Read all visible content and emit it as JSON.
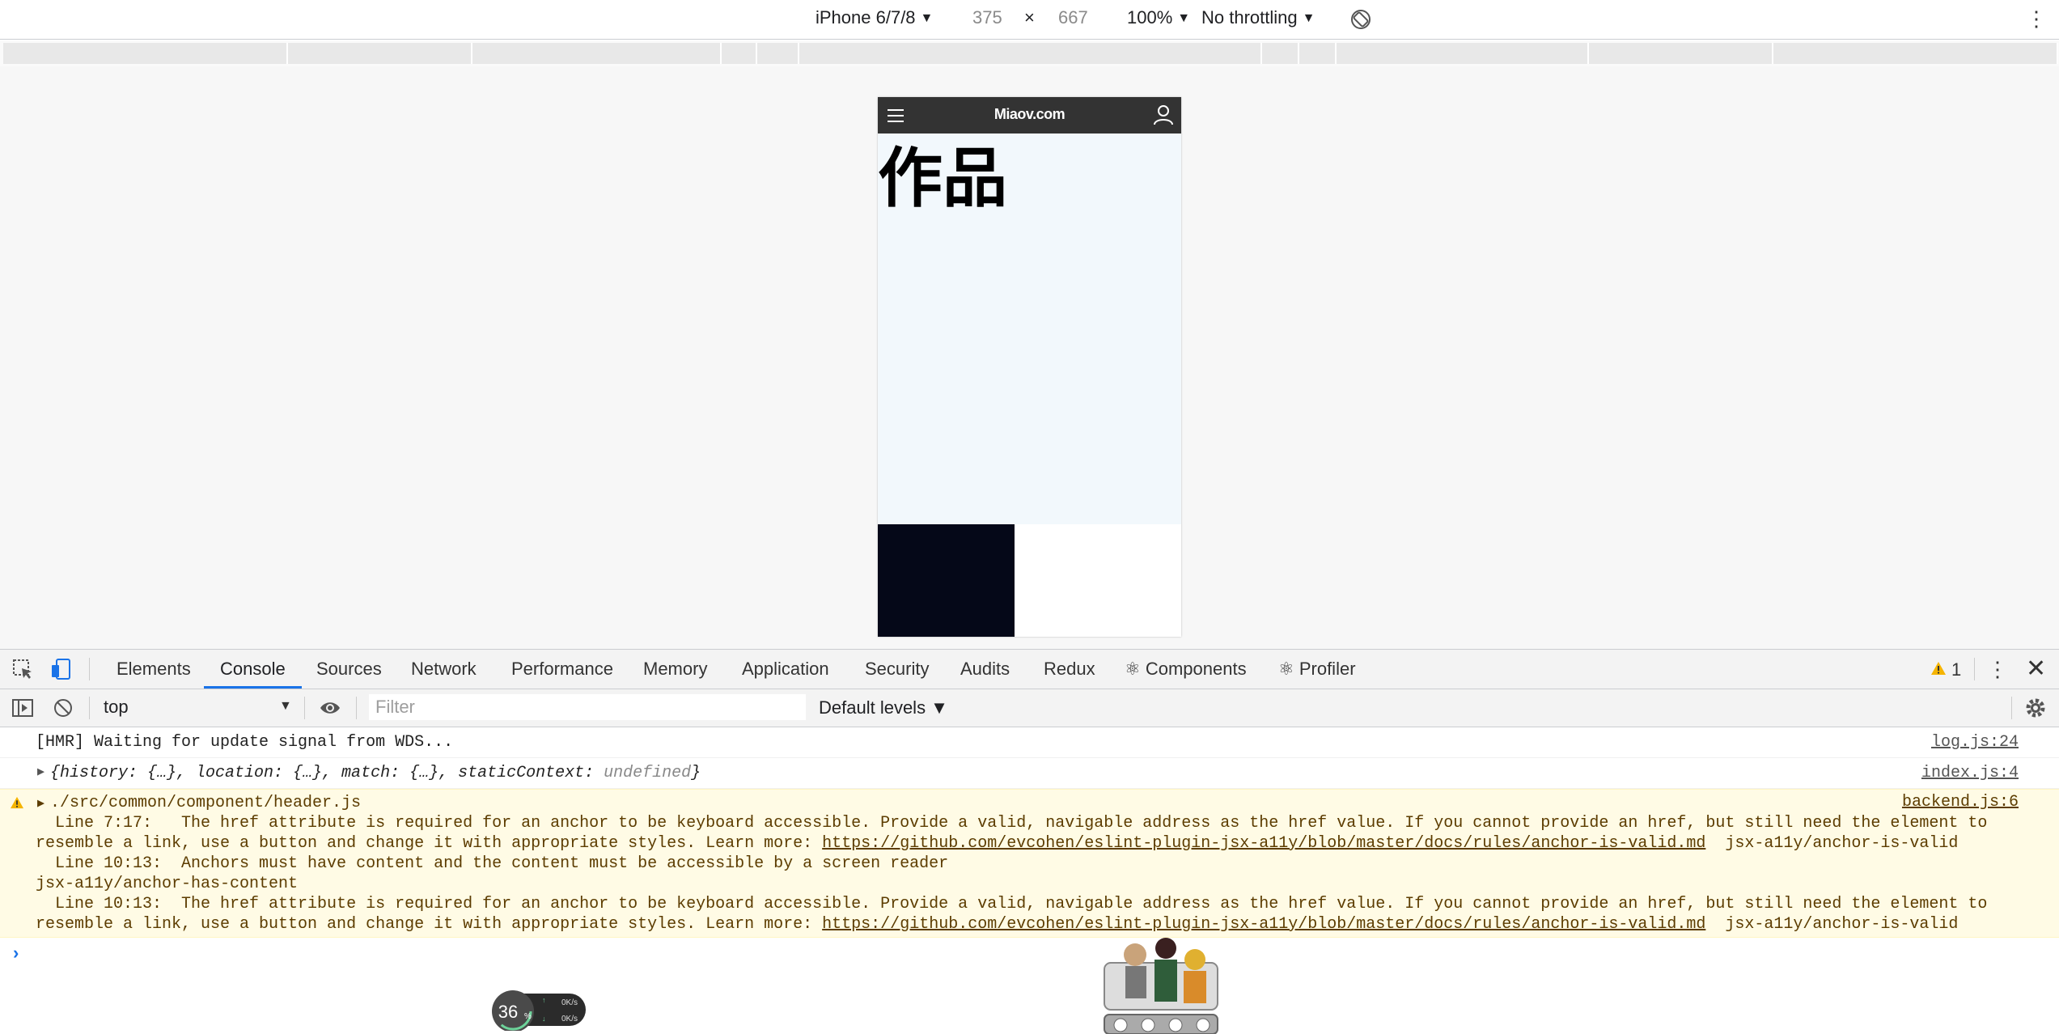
{
  "device_toolbar": {
    "device": "iPhone 6/7/8",
    "width": "375",
    "times": "×",
    "height": "667",
    "zoom": "100%",
    "throttling": "No throttling",
    "caret": "▼",
    "more": "⋮"
  },
  "app": {
    "logo": "Miaov.com",
    "heading": "作品"
  },
  "devtools": {
    "tabs": [
      "Elements",
      "Console",
      "Sources",
      "Network",
      "Performance",
      "Memory",
      "Application",
      "Security",
      "Audits",
      "Redux",
      "⚛ Components",
      "⚛ Profiler"
    ],
    "active_tab": "Console",
    "warning_count": "1",
    "more": "⋮",
    "close": "✕"
  },
  "console_toolbar": {
    "context": "top",
    "filter_placeholder": "Filter",
    "levels": "Default levels ▼"
  },
  "console": {
    "msg1": {
      "text": "[HMR] Waiting for update signal from WDS...",
      "source": "log.js:24"
    },
    "msg2": {
      "text_open": "{history: {…}, location: {…}, match: {…}, staticContext: ",
      "text_undef": "undefined",
      "text_close": "}",
      "source": "index.js:4"
    },
    "warning": {
      "title": "./src/common/component/header.js",
      "source": "backend.js:6",
      "line1": "  Line 7:17:   The href attribute is required for an anchor to be keyboard accessible. Provide a valid, navigable address as the href value. If you cannot provide an href, but still need the element to",
      "line2_pre": "resemble a link, use a button and change it with appropriate styles. Learn more: ",
      "url": "https://github.com/evcohen/eslint-plugin-jsx-a11y/blob/master/docs/rules/anchor-is-valid.md",
      "rule_valid": "  jsx-a11y/anchor-is-valid",
      "line3": "  Line 10:13:  Anchors must have content and the content must be accessible by a screen reader",
      "line4": "jsx-a11y/anchor-has-content",
      "line5": "  Line 10:13:  The href attribute is required for an anchor to be keyboard accessible. Provide a valid, navigable address as the href value. If you cannot provide an href, but still need the element to",
      "line6_pre": "resemble a link, use a button and change it with appropriate styles. Learn more: ",
      "url2": "https://github.com/evcohen/eslint-plugin-jsx-a11y/blob/master/docs/rules/anchor-is-valid.md",
      "rule_valid2": "  jsx-a11y/anchor-is-valid"
    },
    "prompt": "›"
  },
  "speed_widget": {
    "percent": "36",
    "unit": "%",
    "up": "0K/s",
    "down": "0K/s"
  },
  "colors": {
    "header_bg": "#333333",
    "content_bg": "#f2f8fc",
    "accent": "#1a73e8",
    "warning_bg": "#fffbe5"
  }
}
